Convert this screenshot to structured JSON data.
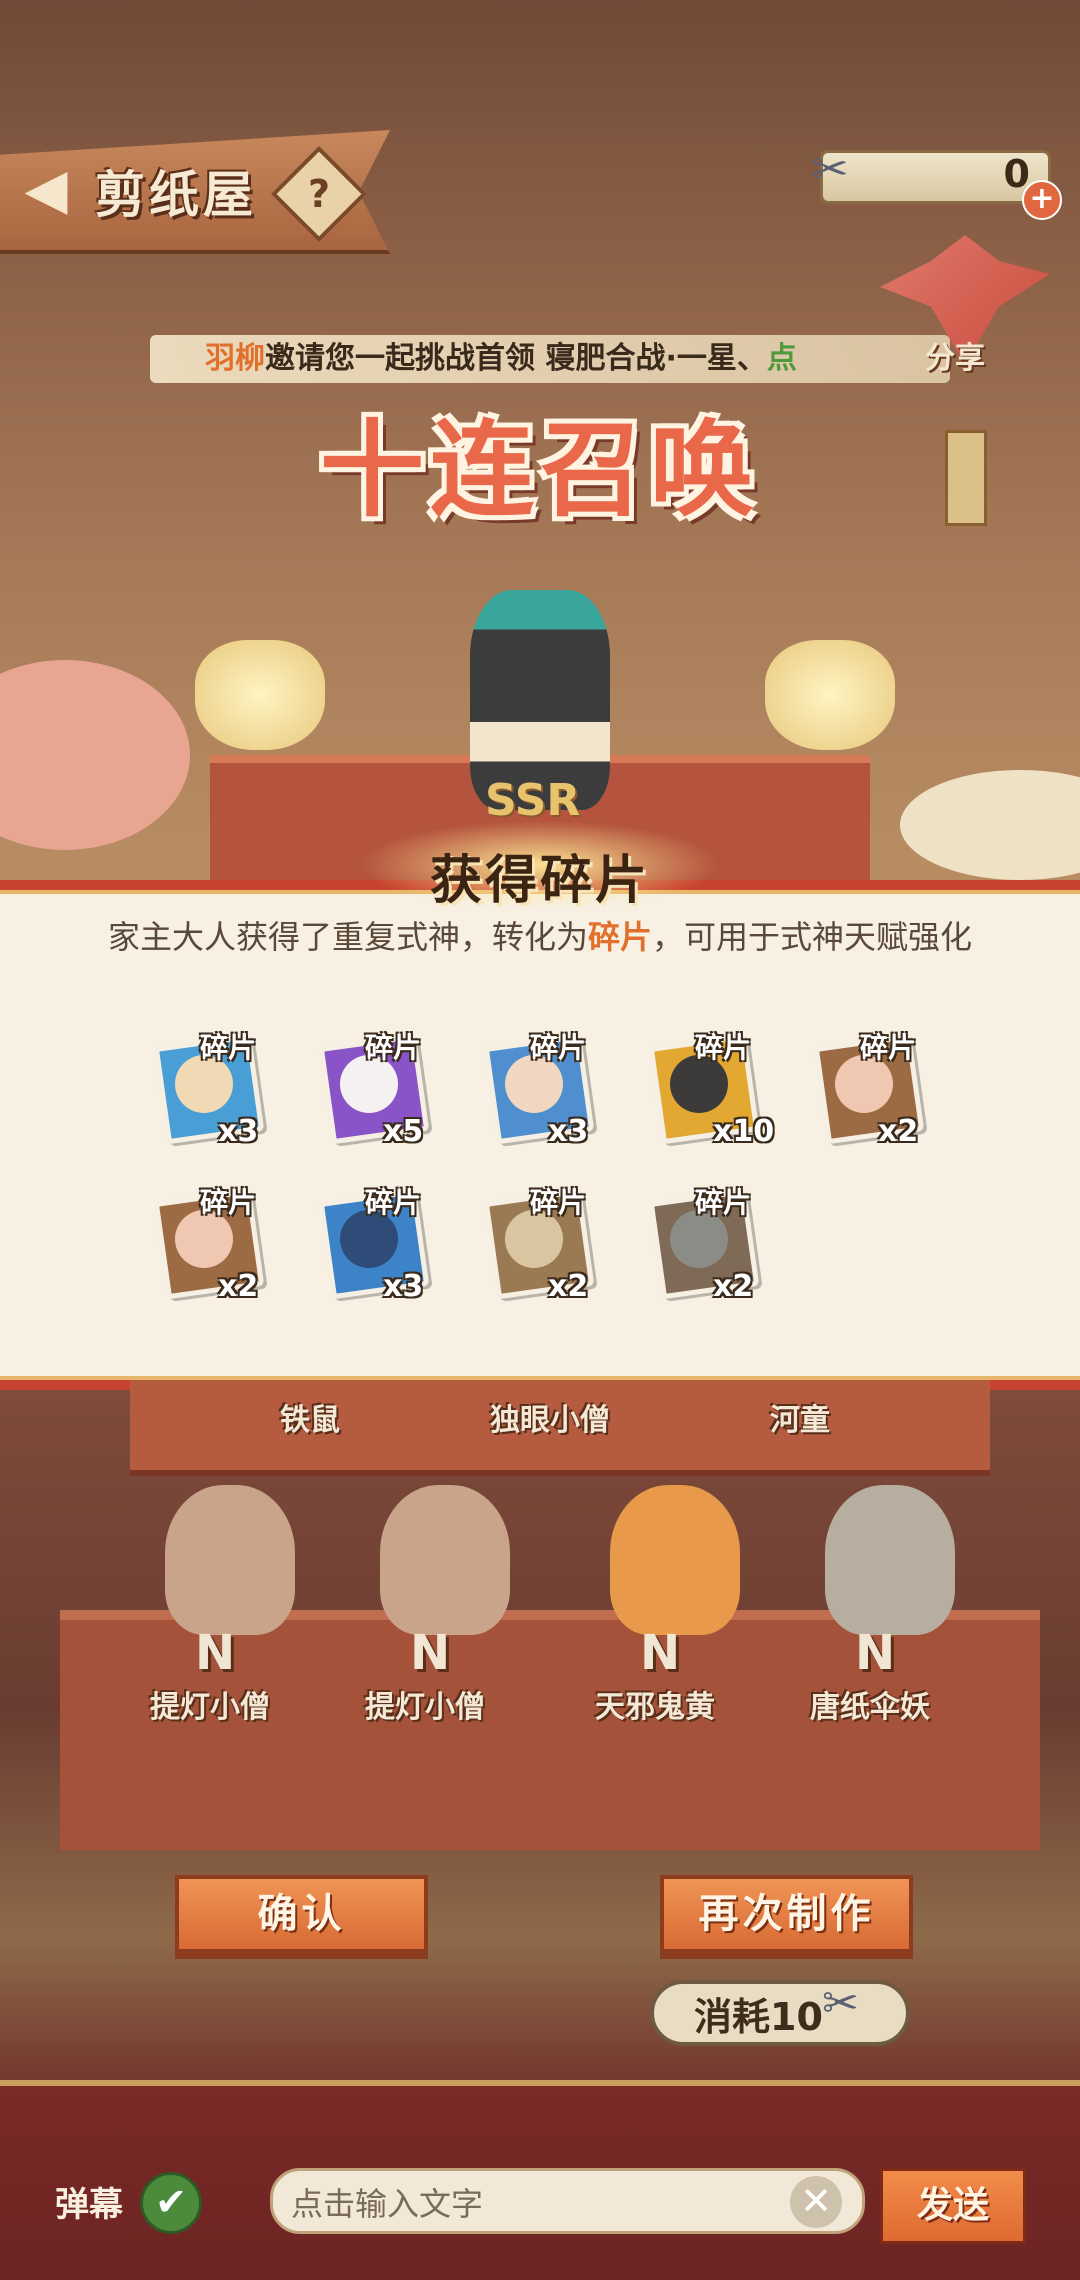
{
  "header": {
    "title": "剪纸屋",
    "back_icon": "◀",
    "help_icon": "?",
    "currency_value": "0",
    "currency_plus": "+"
  },
  "invite": {
    "user": "羽柳",
    "text": "邀请您一起挑战首领 寝肥合战·一星、",
    "click": "点",
    "share": "分享"
  },
  "summon_title": "十连召唤",
  "stage_badge": "SSR",
  "panel": {
    "title": "获得碎片",
    "desc_prefix": "家主大人获得了重复式神，转化为",
    "desc_highlight": "碎片",
    "desc_suffix": "，可用于式神天赋强化",
    "shards": [
      {
        "label": "碎片",
        "count": "x3",
        "bg": "#4a9ed6",
        "face": "#f2d9b5"
      },
      {
        "label": "碎片",
        "count": "x5",
        "bg": "#8a54c9",
        "face": "#f5f1f0"
      },
      {
        "label": "碎片",
        "count": "x3",
        "bg": "#4f8ecf",
        "face": "#f1d6c2"
      },
      {
        "label": "碎片",
        "count": "x10",
        "bg": "#e2a832",
        "face": "#3d3a3a"
      },
      {
        "label": "碎片",
        "count": "x2",
        "bg": "#9c6a43",
        "face": "#f0c7b0"
      },
      {
        "label": "碎片",
        "count": "x2",
        "bg": "#9c6a43",
        "face": "#f0c7b0"
      },
      {
        "label": "碎片",
        "count": "x3",
        "bg": "#3c83c7",
        "face": "#2f4b78"
      },
      {
        "label": "碎片",
        "count": "x2",
        "bg": "#9a7a52",
        "face": "#d9c6a0"
      },
      {
        "label": "碎片",
        "count": "x2",
        "bg": "#7f6a57",
        "face": "#8c8c86"
      }
    ]
  },
  "results_top": [
    "铁鼠",
    "独眼小僧",
    "河童"
  ],
  "results_bottom": [
    {
      "name": "提灯小僧",
      "rarity": "N"
    },
    {
      "name": "提灯小僧",
      "rarity": "N"
    },
    {
      "name": "天邪鬼黄",
      "rarity": "N"
    },
    {
      "name": "唐纸伞妖",
      "rarity": "N"
    }
  ],
  "buttons": {
    "confirm": "确认",
    "again": "再次制作",
    "cost": "消耗10"
  },
  "chat": {
    "danmu_label": "弹幕",
    "check": "✔",
    "placeholder": "点击输入文字",
    "clear": "✕",
    "send": "发送"
  }
}
